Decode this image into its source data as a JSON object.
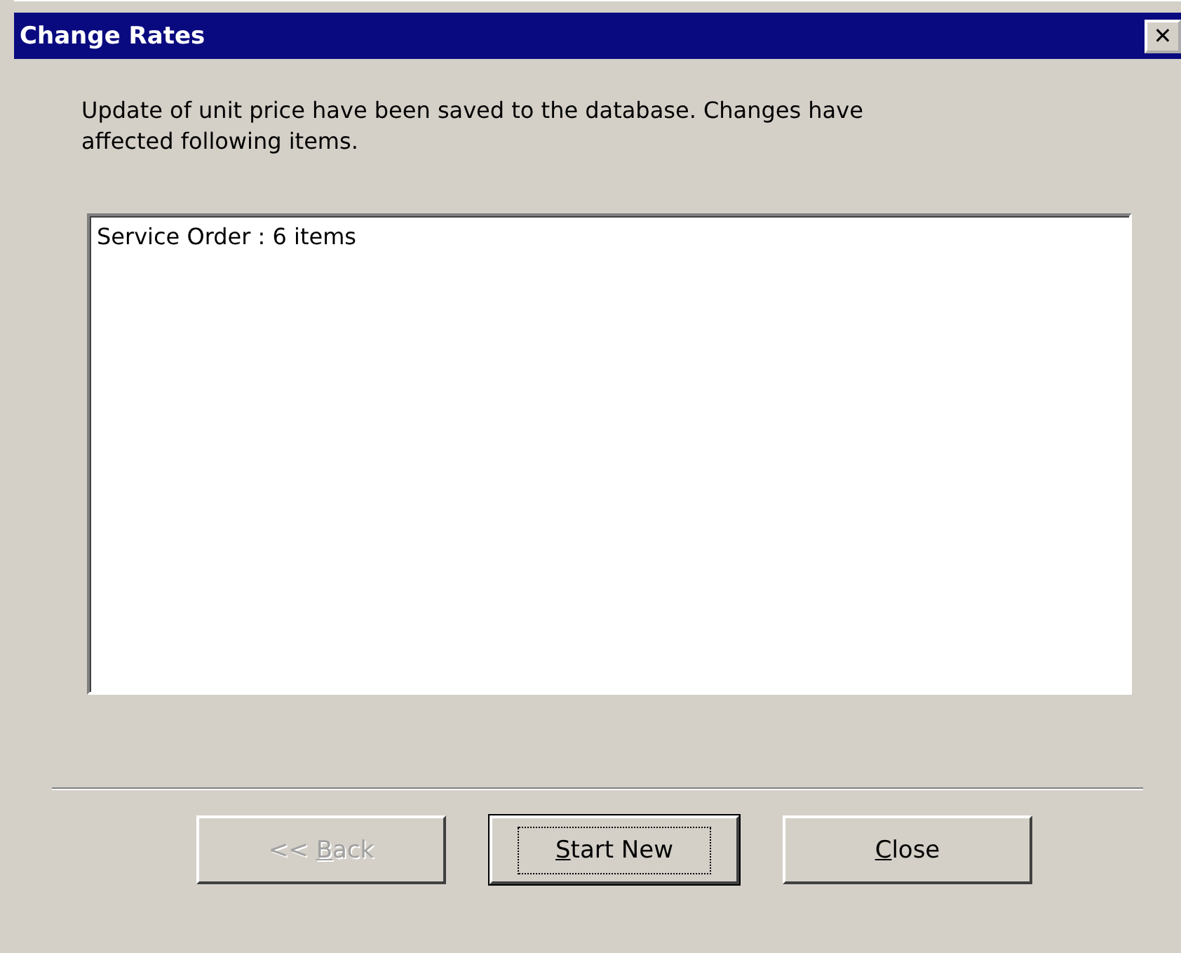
{
  "window": {
    "title": "Change Rates",
    "close_glyph": "✕"
  },
  "message": "Update of unit price have been saved to the database. Changes have affected following items.",
  "list": {
    "items": [
      "Service Order : 6 items"
    ]
  },
  "buttons": [
    {
      "label": {
        "before": "<< ",
        "key": "B",
        "after": "ack"
      },
      "disabled": true,
      "default": false
    },
    {
      "label": {
        "key": "S",
        "after": "tart New"
      },
      "disabled": false,
      "default": true
    },
    {
      "label": {
        "key": "C",
        "after": "lose"
      },
      "disabled": false,
      "default": false
    }
  ]
}
